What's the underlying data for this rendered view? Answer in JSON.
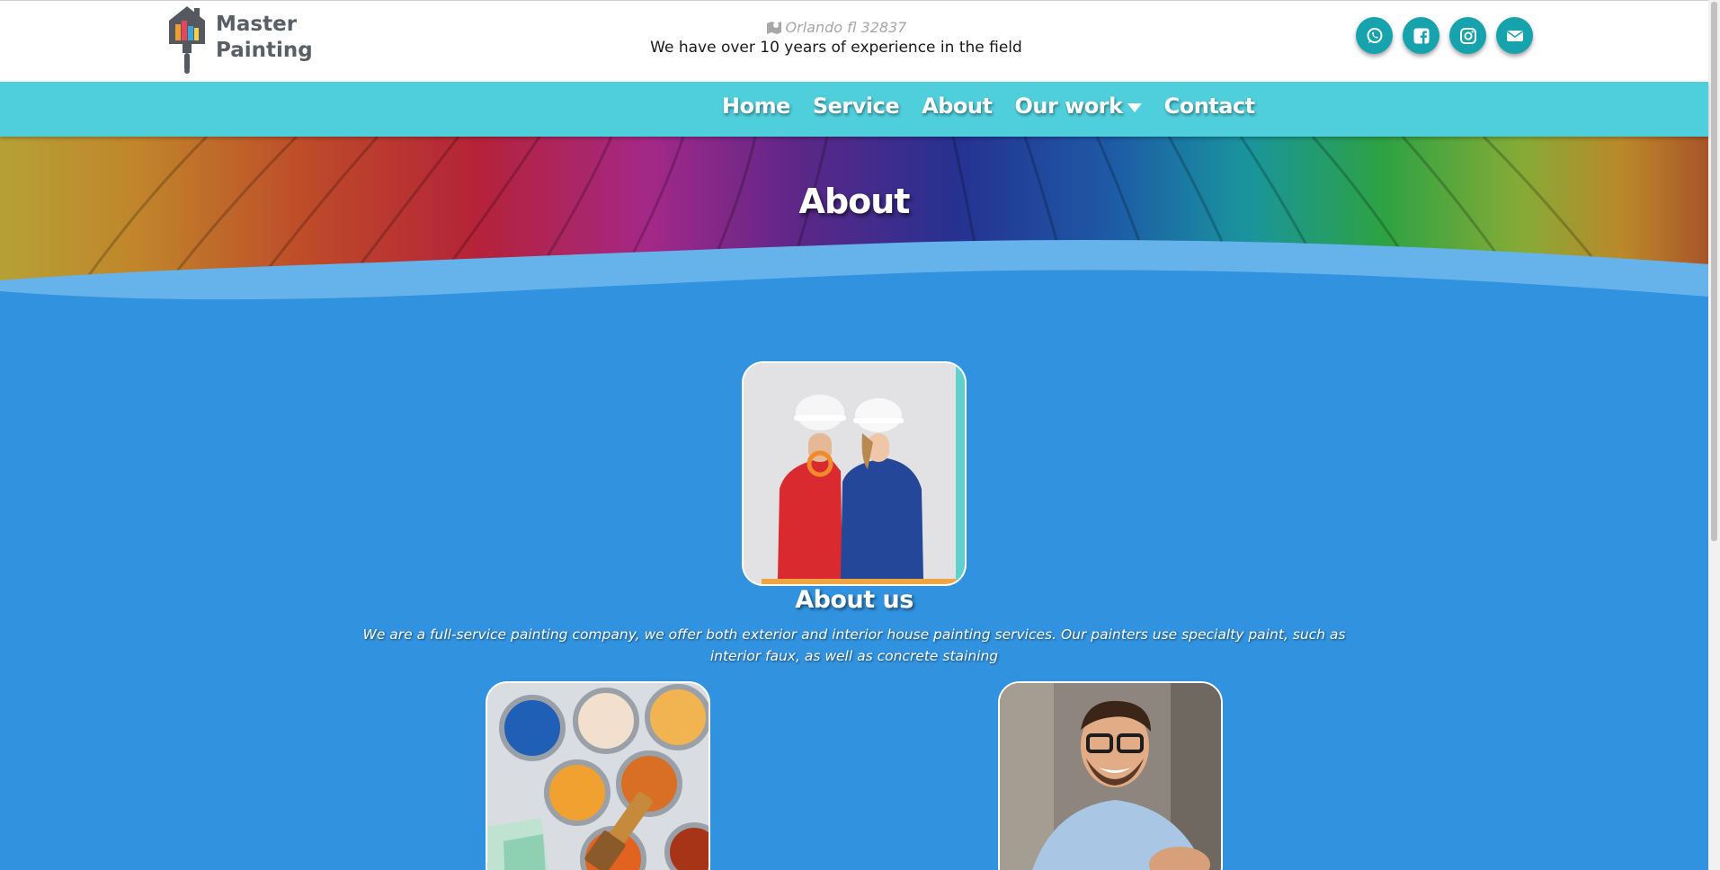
{
  "header": {
    "logo": {
      "line1": "Master",
      "line2": "Painting",
      "icon": "house-paintbrush-logo-icon"
    },
    "location": {
      "icon": "map-icon",
      "text": "Orlando fl 32837"
    },
    "experience": "We have over 10 years of experience in the field",
    "socials": [
      {
        "name": "whatsapp",
        "icon": "whatsapp-icon"
      },
      {
        "name": "facebook",
        "icon": "facebook-icon"
      },
      {
        "name": "instagram",
        "icon": "instagram-icon"
      },
      {
        "name": "email",
        "icon": "envelope-icon"
      }
    ],
    "social_color": "#17a3ad"
  },
  "nav": {
    "items": [
      {
        "label": "Home"
      },
      {
        "label": "Service"
      },
      {
        "label": "About"
      },
      {
        "label": "Our work",
        "dropdown": true
      },
      {
        "label": "Contact"
      }
    ],
    "color": "#4fcfdb"
  },
  "hero": {
    "title": "About"
  },
  "about": {
    "heading": "About us",
    "text": "We are a full-service painting company, we offer both exterior and interior house painting services. Our painters use specialty paint, such as interior faux, as well as concrete staining"
  },
  "colors": {
    "page_background": "#3192e0",
    "wave": "#66b3ec"
  }
}
